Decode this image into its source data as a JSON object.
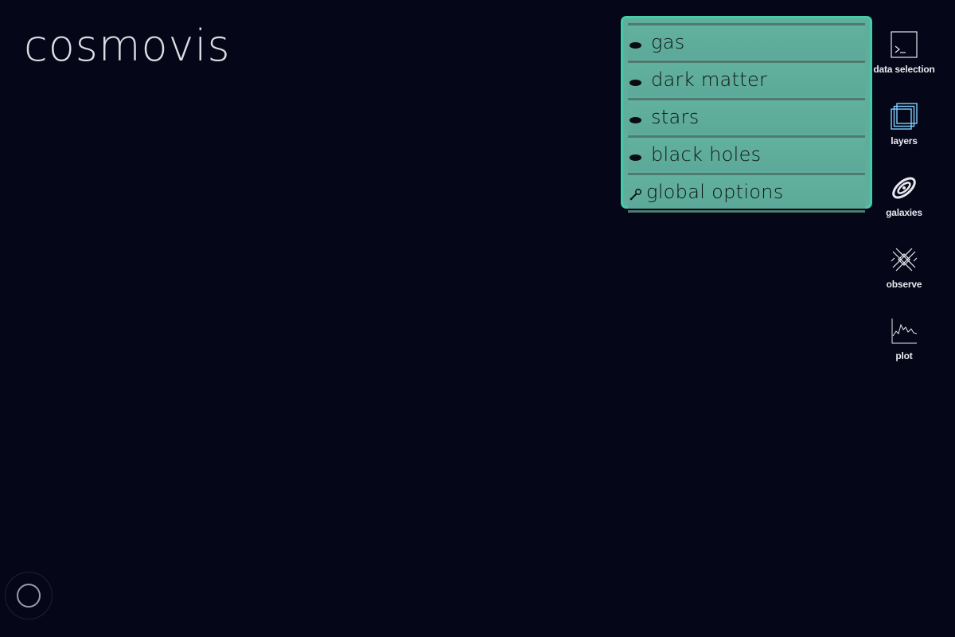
{
  "app": {
    "title": "cosmovis"
  },
  "layers_panel": {
    "items": [
      {
        "label": "gas",
        "icon": "eye-icon"
      },
      {
        "label": "dark matter",
        "icon": "eye-icon"
      },
      {
        "label": "stars",
        "icon": "eye-icon"
      },
      {
        "label": "black holes",
        "icon": "eye-icon"
      },
      {
        "label": "global options",
        "icon": "wrench-icon"
      }
    ],
    "colors": {
      "border": "#46cba8",
      "background": "#5fae9c"
    }
  },
  "toolbar": {
    "items": [
      {
        "label": "data selection",
        "icon": "terminal-icon"
      },
      {
        "label": "layers",
        "icon": "layers-icon"
      },
      {
        "label": "galaxies",
        "icon": "galaxy-icon"
      },
      {
        "label": "observe",
        "icon": "telescope-icon"
      },
      {
        "label": "plot",
        "icon": "plot-icon"
      }
    ]
  },
  "loader": {
    "icon": "loading-circle-icon"
  },
  "theme": {
    "background": "#050617",
    "accent": "#46cba8",
    "icon_accent": "#7fd0ff"
  }
}
